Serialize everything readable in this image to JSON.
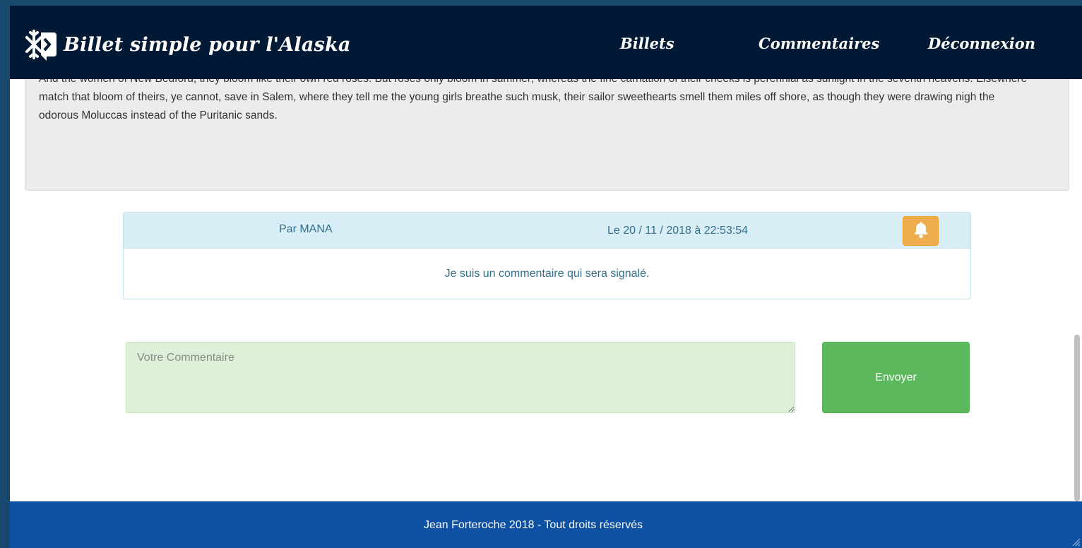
{
  "navbar": {
    "brand_title": "Billet simple pour l'Alaska",
    "logo_icon": "snowflake-icon",
    "links": {
      "billets": "Billets",
      "commentaires": "Commentaires",
      "deconnexion": "Déconnexion"
    }
  },
  "article": {
    "text_partial_top": "And the women of New Bedford, they bloom like their own red roses. But roses only bloom in summer; whereas the fine carnation of their cheeks is perennial as sunlight in the seventh",
    "text_visible": "heavens. Elsewhere match that bloom of theirs, ye cannot, save in Salem, where they tell me the young girls breathe such musk, their sailor sweethearts smell them miles off shore, as though they were drawing nigh the odorous Moluccas instead of the Puritanic sands."
  },
  "comment": {
    "author": "Par MANA",
    "date": "Le 20 / 11 / 2018 à 22:53:54",
    "report_icon": "bell-icon",
    "body": "Je suis un commentaire qui sera signalé."
  },
  "comment_form": {
    "placeholder": "Votre Commentaire",
    "value": "",
    "submit_label": "Envoyer"
  },
  "footer": {
    "text": "Jean Forteroche 2018 - Tout droits réservés"
  },
  "colors": {
    "navbar_bg": "#001a36",
    "footer_bg": "#0d51a4",
    "comment_header_bg": "#d9edf7",
    "report_button": "#f0ad4e",
    "send_button": "#5cb85c",
    "input_bg": "#dff0d8"
  }
}
